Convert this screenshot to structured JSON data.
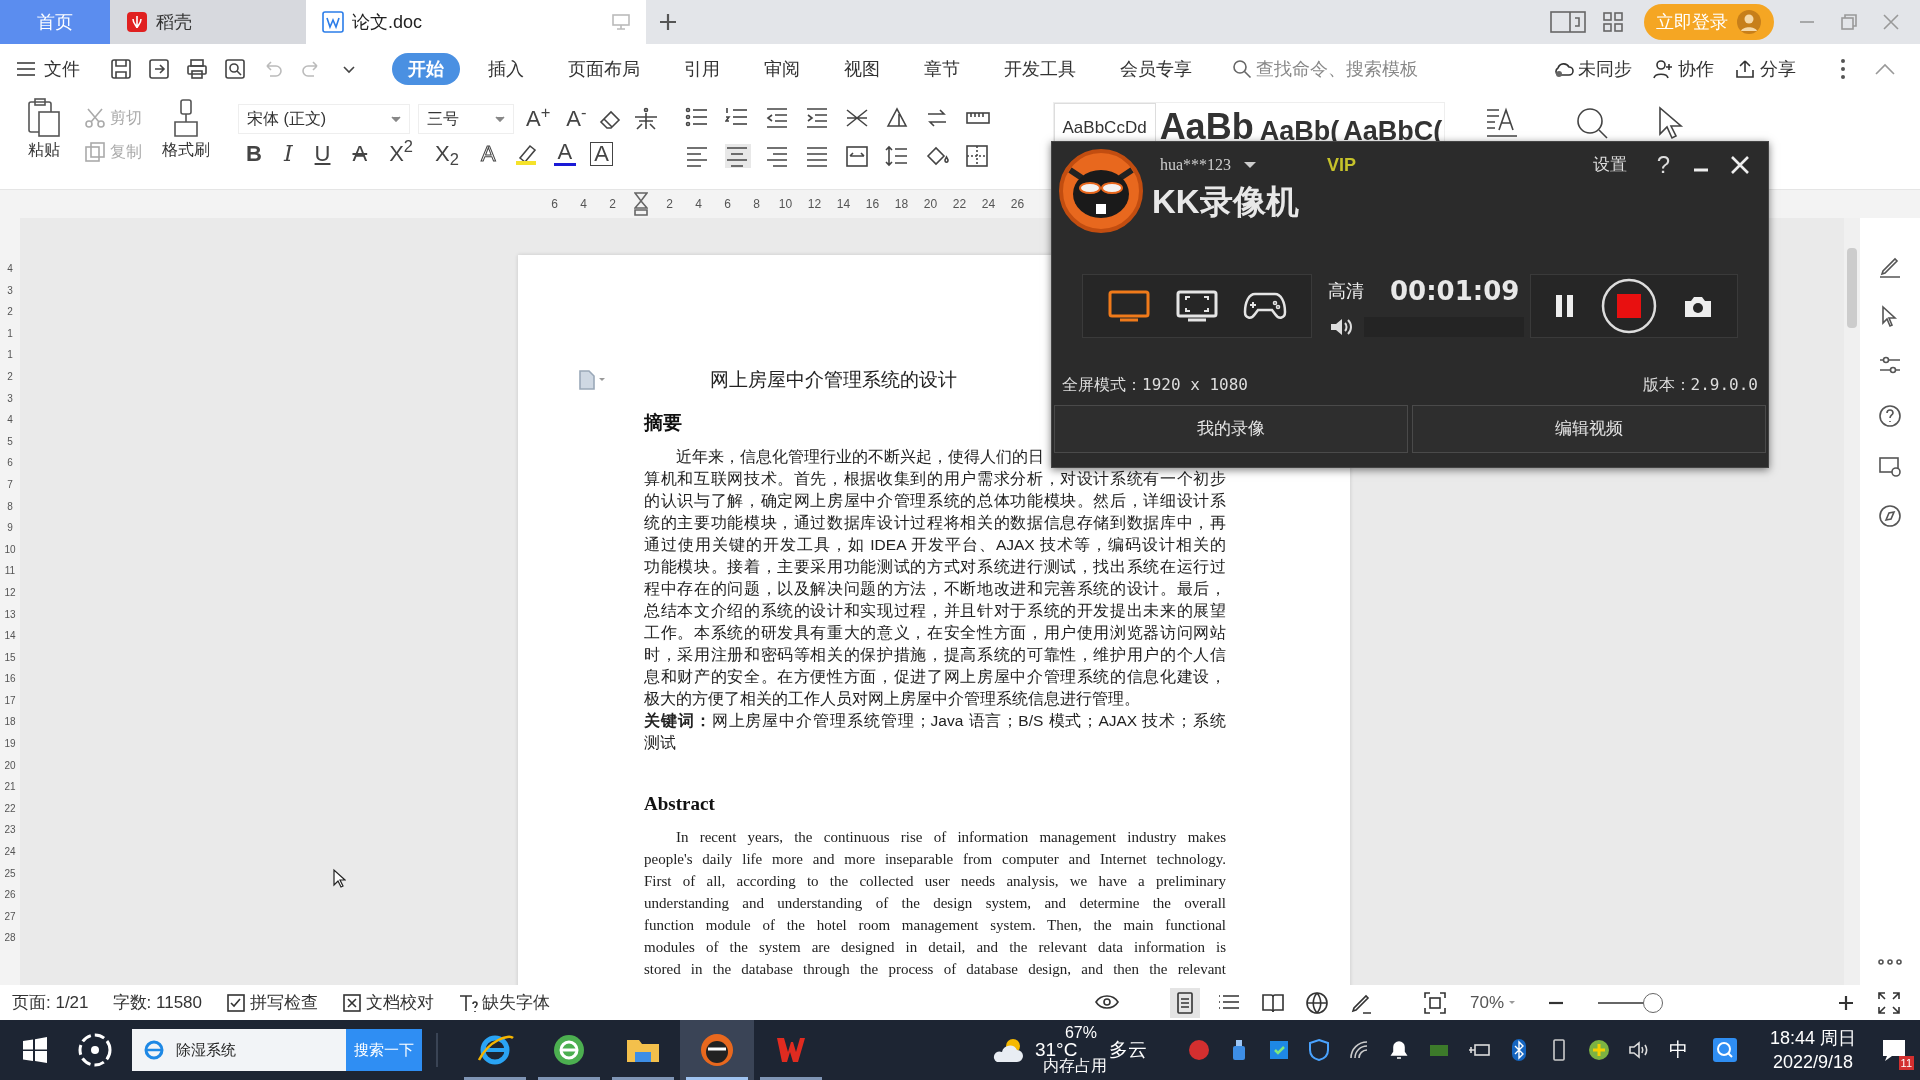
{
  "tabs": [
    {
      "label": "首页",
      "kind": "home",
      "selected": false
    },
    {
      "label": "稻壳",
      "kind": "docer",
      "selected": false
    },
    {
      "label": "论文.doc",
      "kind": "doc",
      "selected": true
    }
  ],
  "login_button": "立即登录",
  "file_menu": "文件",
  "ribbon_tabs": [
    {
      "label": "开始",
      "selected": true
    },
    {
      "label": "插入",
      "selected": false
    },
    {
      "label": "页面布局",
      "selected": false
    },
    {
      "label": "引用",
      "selected": false
    },
    {
      "label": "审阅",
      "selected": false
    },
    {
      "label": "视图",
      "selected": false
    },
    {
      "label": "章节",
      "selected": false
    },
    {
      "label": "开发工具",
      "selected": false
    },
    {
      "label": "会员专享",
      "selected": false
    }
  ],
  "command_search": {
    "placeholder": "查找命令、搜索模板"
  },
  "header_actions": [
    {
      "kind": "cloud",
      "label": "未同步"
    },
    {
      "kind": "collab",
      "label": "协作"
    },
    {
      "kind": "share",
      "label": "分享"
    }
  ],
  "clipboard": {
    "paste": "粘贴",
    "cut": {
      "label": "剪切",
      "disabled": true
    },
    "copy": {
      "label": "复制",
      "disabled": true
    },
    "format_painter": "格式刷"
  },
  "font": {
    "family": "宋体 (正文)",
    "size": "三号"
  },
  "size_buttons": [
    "A$^{+}$",
    "A$^{-}$"
  ],
  "format_buttons": [
    {
      "kind": "bold",
      "label": "B"
    },
    {
      "kind": "italic",
      "label": "I"
    },
    {
      "kind": "underline",
      "label": "U"
    },
    {
      "kind": "strike",
      "label": "A"
    },
    {
      "kind": "sup",
      "label": "X$^{2}$"
    },
    {
      "kind": "sub",
      "label": "X$_{2}$"
    },
    {
      "kind": "outline",
      "label": "A"
    },
    {
      "kind": "highlight"
    },
    {
      "kind": "color",
      "label": "A"
    },
    {
      "kind": "border",
      "label": "A"
    }
  ],
  "styles": [
    "AaBbCcDd",
    "AaBb",
    "AaBb(",
    "AaBbC("
  ],
  "ruler": [
    "6",
    "4",
    "2",
    "2",
    "4",
    "6",
    "8",
    "10",
    "12",
    "14",
    "16",
    "18",
    "20",
    "22",
    "24",
    "26"
  ],
  "vertical_ruler": [
    "4",
    "3",
    "2",
    "1",
    "1",
    "2",
    "3",
    "4",
    "5",
    "6",
    "7",
    "8",
    "9",
    "10",
    "11",
    "12",
    "13",
    "14",
    "15",
    "16",
    "17",
    "18",
    "19",
    "20",
    "21",
    "22",
    "23",
    "24",
    "25",
    "26",
    "27",
    "28"
  ],
  "document": {
    "title": "网上房屋中介管理系统的设计",
    "abstract_heading": "摘要",
    "abstract_lines": [
      "近年来，信息化管理行业的不断兴起，使得人们的日",
      "算机和互联网技术。首先，根据收集到的用户需求分析，对设计系统有一个初步",
      "的认识与了解，确定网上房屋中介管理系统的总体功能模块。然后，详细设计系",
      "统的主要功能模块，通过数据库设计过程将相关的数据信息存储到数据库中，再",
      "通过使用关键的开发工具，如 IDEA 开发平台、AJAX 技术等，编码设计相关的",
      "功能模块。接着，主要采用功能测试的方式对系统进行测试，找出系统在运行过",
      "程中存在的问题，以及解决问题的方法，不断地改进和完善系统的设计。最后，",
      "总结本文介绍的系统的设计和实现过程，并且针对于系统的开发提出未来的展望",
      "工作。本系统的研发具有重大的意义，在安全性方面，用户使用浏览器访问网站",
      "时，采用注册和密码等相关的保护措施，提高系统的可靠性，维护用户的个人信",
      "息和财产的安全。在方便性方面，促进了网上房屋中介管理系统的信息化建设，",
      "极大的方便了相关的工作人员对网上房屋中介管理系统信息进行管理。"
    ],
    "keyword_lines": [
      "**关键词：**网上房屋中介管理系统管理；Java 语言；B/S 模式；AJAX 技术；系统",
      "测试"
    ],
    "en_heading": "Abstract",
    "en_lines": [
      "In recent years, the continuous rise of information management industry makes",
      "people's daily life more and more inseparable from computer and Internet technology.",
      "First of all, according to the collected user needs analysis, we have a preliminary",
      "understanding and understanding of the design system, and determine the overall",
      "function module of the hotel room management system. Then, the main functional",
      "modules of the system are designed in detail, and the relevant data information is",
      "stored in the database through the process of database design, and then the relevant"
    ]
  },
  "status_bar": {
    "page": "页面: 1/21",
    "words": "字数: 11580",
    "tools": [
      {
        "kind": "spell",
        "label": "拼写检查"
      },
      {
        "kind": "proof",
        "label": "文档校对"
      },
      {
        "kind": "font",
        "label": "缺失字体"
      }
    ],
    "view_modes": [
      {
        "kind": "eye",
        "selected": false
      },
      {
        "kind": "page",
        "selected": true
      },
      {
        "kind": "outline",
        "selected": false
      },
      {
        "kind": "read",
        "selected": false
      },
      {
        "kind": "web",
        "selected": false
      },
      {
        "kind": "pen",
        "selected": false
      }
    ],
    "zoom": "70%",
    "zoom_slider": {
      "level": 0.88
    }
  },
  "recorder": {
    "user": "hua***123",
    "vip": "VIP",
    "settings": "设置",
    "help": "?",
    "title": "KK录像机",
    "modes": [
      {
        "kind": "fullscreen",
        "selected": true
      },
      {
        "kind": "region",
        "selected": false
      },
      {
        "kind": "game",
        "selected": false
      }
    ],
    "quality": "高清",
    "timer": "00:01:09",
    "recording": true,
    "mode_info": "全屏模式：1920 x 1080",
    "version": "版本：2.9.0.0",
    "buttons": [
      "我的录像",
      "编辑视频"
    ]
  },
  "taskbar": {
    "search": {
      "value": "除湿系统",
      "button": "搜索一下"
    },
    "apps": [
      {
        "kind": "ie",
        "selected": false
      },
      {
        "kind": "green",
        "selected": false
      },
      {
        "kind": "folder",
        "selected": false
      },
      {
        "kind": "kk",
        "selected": true
      },
      {
        "kind": "wps",
        "selected": false
      }
    ],
    "weather": {
      "temp": "31°C",
      "condition": "多云",
      "memory": "67%",
      "memory_label": "内存占用"
    },
    "ime": "中",
    "time": "18:44 周日",
    "date": "2022/9/18",
    "notifications": "11"
  }
}
